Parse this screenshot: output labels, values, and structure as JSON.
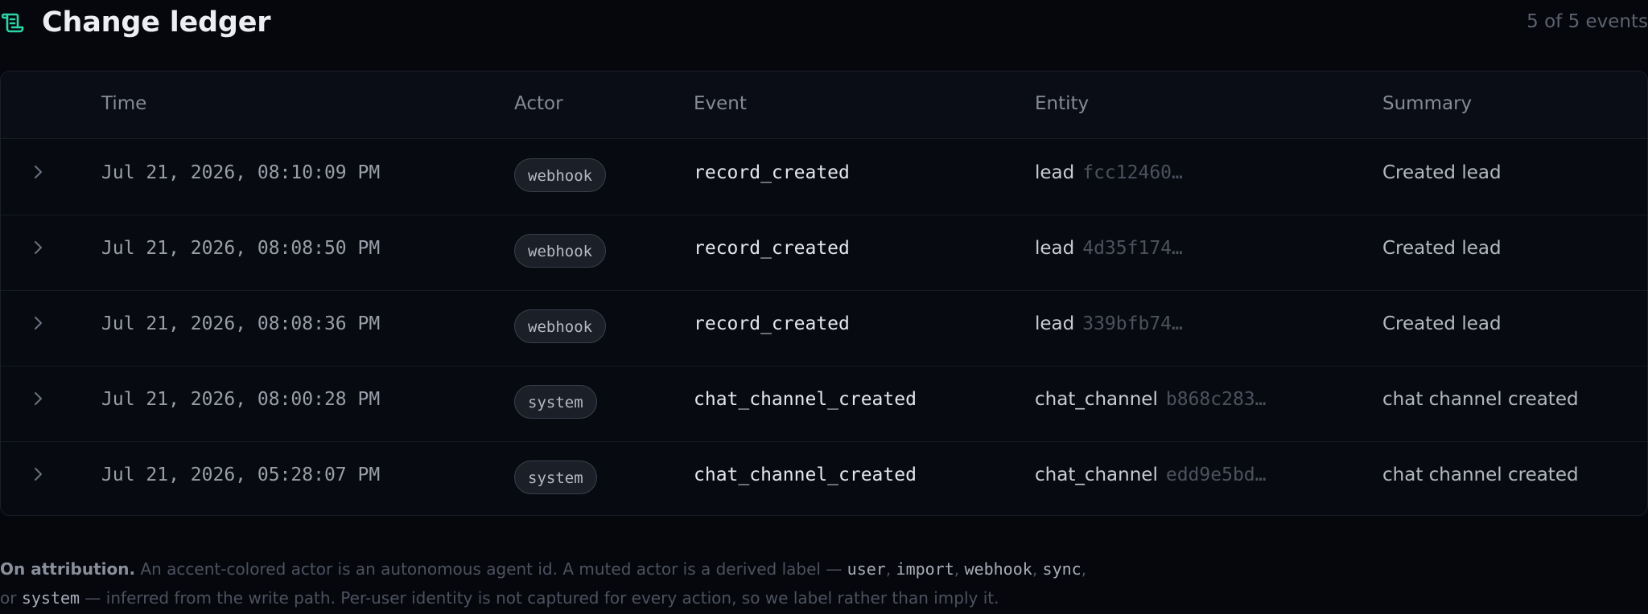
{
  "header": {
    "icon": "scroll-icon",
    "title": "Change ledger",
    "count": "5 of 5 events"
  },
  "colors": {
    "accent": "#2dd4a6",
    "background": "#05070d",
    "muted_text": "#5d6270"
  },
  "table": {
    "columns": {
      "time": "Time",
      "actor": "Actor",
      "event": "Event",
      "entity": "Entity",
      "summary": "Summary"
    },
    "rows": [
      {
        "time": "Jul 21, 2026, 08:10:09 PM",
        "actor": "webhook",
        "event": "record_created",
        "entity_type": "lead",
        "entity_id": "fcc12460…",
        "summary": "Created lead"
      },
      {
        "time": "Jul 21, 2026, 08:08:50 PM",
        "actor": "webhook",
        "event": "record_created",
        "entity_type": "lead",
        "entity_id": "4d35f174…",
        "summary": "Created lead"
      },
      {
        "time": "Jul 21, 2026, 08:08:36 PM",
        "actor": "webhook",
        "event": "record_created",
        "entity_type": "lead",
        "entity_id": "339bfb74…",
        "summary": "Created lead"
      },
      {
        "time": "Jul 21, 2026, 08:00:28 PM",
        "actor": "system",
        "event": "chat_channel_created",
        "entity_type": "chat_channel",
        "entity_id": "b868c283…",
        "summary": "chat channel created"
      },
      {
        "time": "Jul 21, 2026, 05:28:07 PM",
        "actor": "system",
        "event": "chat_channel_created",
        "entity_type": "chat_channel",
        "entity_id": "edd9e5bd…",
        "summary": "chat channel created"
      }
    ]
  },
  "footnote": {
    "lead": "On attribution.",
    "text1": " An accent-colored actor is an autonomous agent id. A muted actor is a derived label — ",
    "label_user": "user",
    "sep1": ", ",
    "label_import": "import",
    "sep2": ", ",
    "label_webhook": "webhook",
    "sep3": ", ",
    "label_sync": "sync",
    "sep4": ",",
    "text2": "or ",
    "label_system": "system",
    "text3": " — inferred from the write path. Per-user identity is not captured for every action, so we label rather than imply it."
  }
}
